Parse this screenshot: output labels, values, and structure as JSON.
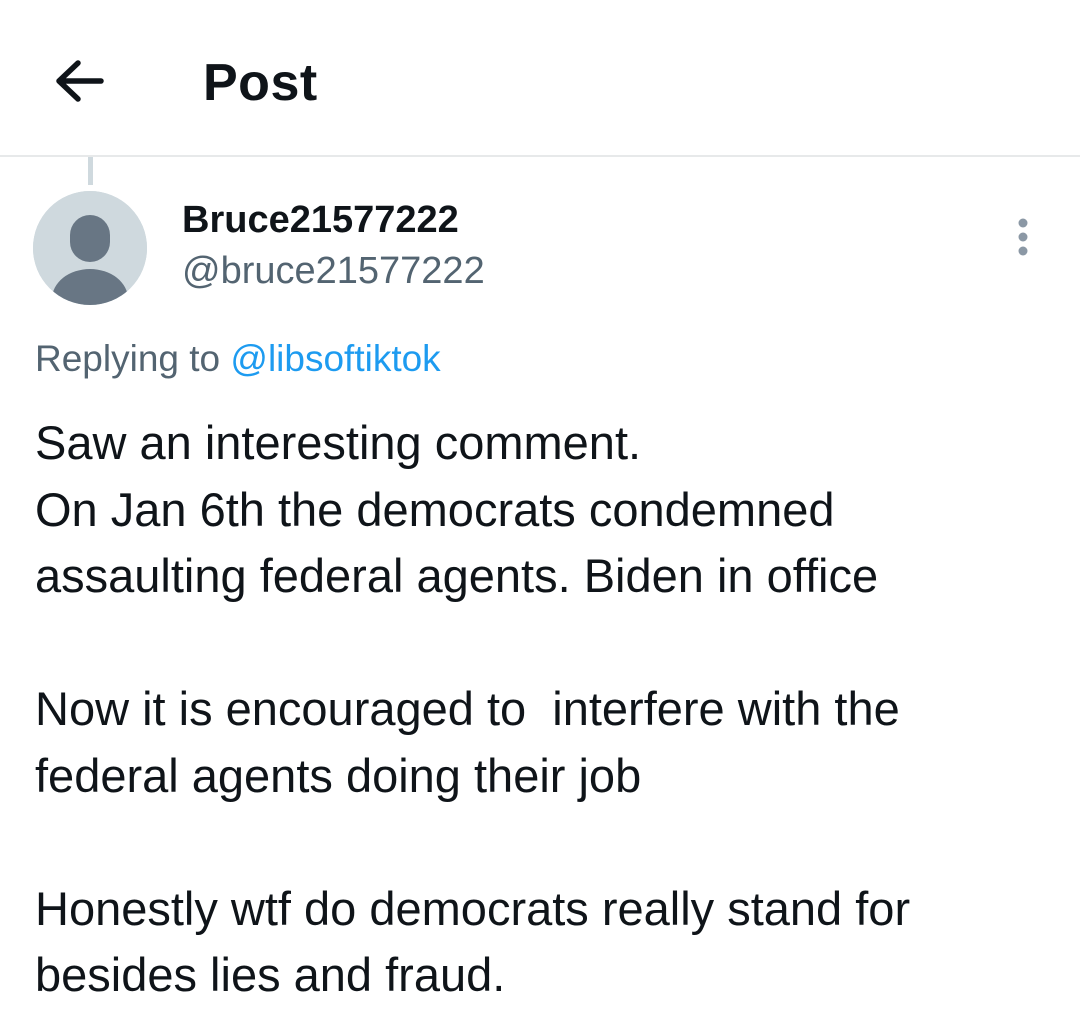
{
  "header": {
    "title": "Post",
    "back_icon": "arrow-left-icon"
  },
  "post": {
    "author": {
      "display_name": "Bruce21577222",
      "handle": "@bruce21577222",
      "avatar_icon": "default-user-avatar-icon"
    },
    "more_icon": "vertical-ellipsis-icon",
    "reply": {
      "prefix": "Replying to",
      "handle": "@libsoftiktok"
    },
    "text_lines": [
      "Saw an interesting comment.",
      "On Jan 6th the democrats condemned",
      "assaulting federal agents. Biden in office",
      "",
      "Now it is encouraged to  interfere with the",
      "federal agents doing their job",
      "",
      "Honestly wtf do democrats really stand for",
      "besides lies and fraud."
    ]
  },
  "colors": {
    "text_primary": "#0f1419",
    "text_secondary": "#536471",
    "link": "#1d9bf0",
    "divider": "#e7e9ea",
    "avatar_bg": "#cfd9de",
    "avatar_figure": "#687684"
  }
}
